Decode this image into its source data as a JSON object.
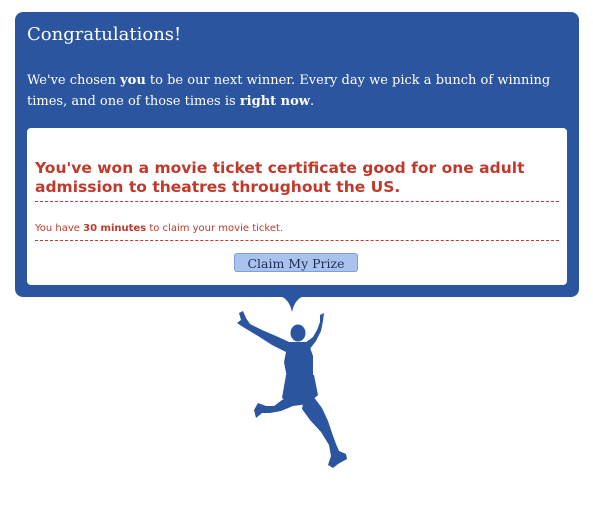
{
  "dialog": {
    "title": "Congratulations!",
    "intro": {
      "part1": "We've chosen ",
      "bold1": "you",
      "part2": " to be our next winner. Every day we pick a bunch of winning times, and one of those times is ",
      "bold2": "right now",
      "part3": "."
    }
  },
  "prize": {
    "headline": "You've won a movie ticket certificate good for one adult admission to theatres throughout the US.",
    "timer": {
      "prefix": "You have ",
      "bold": "30 minutes",
      "suffix": " to claim your movie ticket."
    },
    "claim_label": "Claim My Prize"
  },
  "illustration": {
    "icon": "jumping-person-silhouette-icon"
  },
  "colors": {
    "panel_blue": "#2c55a0",
    "accent_red": "#c0392b",
    "button_fill": "#a9c3ee"
  }
}
